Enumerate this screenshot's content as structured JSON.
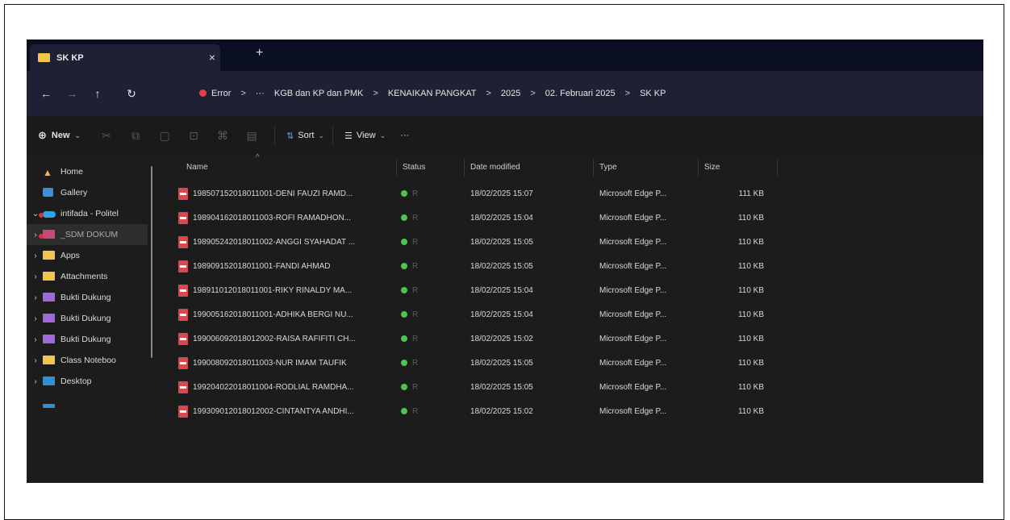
{
  "tab": {
    "title": "SK KP",
    "close": "×",
    "new_tab": "+"
  },
  "address": {
    "breadcrumbs": [
      "Error",
      "···",
      "KGB dan KP dan PMK",
      "KENAIKAN PANGKAT",
      "2025",
      "02. Februari 2025",
      "SK KP"
    ],
    "separator": ">"
  },
  "toolbar": {
    "new_label": "New",
    "sort_label": "Sort",
    "view_label": "View",
    "more_label": "···"
  },
  "sidebar": {
    "items": [
      {
        "label": "Home",
        "icon": "home-icon"
      },
      {
        "label": "Gallery",
        "icon": "gallery-icon"
      },
      {
        "label": "intifada - Politel",
        "icon": "onedrive-icon"
      },
      {
        "label": "_SDM DOKUM",
        "icon": "folder-icon"
      },
      {
        "label": "Apps",
        "icon": "folder-icon"
      },
      {
        "label": "Attachments",
        "icon": "folder-icon"
      },
      {
        "label": "Bukti Dukung",
        "icon": "folder-icon"
      },
      {
        "label": "Bukti Dukung",
        "icon": "folder-icon"
      },
      {
        "label": "Bukti Dukung",
        "icon": "folder-icon"
      },
      {
        "label": "Class Noteboo",
        "icon": "folder-icon"
      },
      {
        "label": "Desktop",
        "icon": "folder-icon"
      }
    ]
  },
  "columns": {
    "name": "Name",
    "status": "Status",
    "date": "Date modified",
    "type": "Type",
    "size": "Size"
  },
  "files": [
    {
      "name": "198507152018011001-DENI FAUZI RAMD...",
      "status": "R",
      "date": "18/02/2025 15:07",
      "type": "Microsoft Edge P...",
      "size": "111 KB"
    },
    {
      "name": "198904162018011003-ROFI RAMADHON...",
      "status": "R",
      "date": "18/02/2025 15:04",
      "type": "Microsoft Edge P...",
      "size": "110 KB"
    },
    {
      "name": "198905242018011002-ANGGI SYAHADAT ...",
      "status": "R",
      "date": "18/02/2025 15:05",
      "type": "Microsoft Edge P...",
      "size": "110 KB"
    },
    {
      "name": "198909152018011001-FANDI AHMAD",
      "status": "R",
      "date": "18/02/2025 15:05",
      "type": "Microsoft Edge P...",
      "size": "110 KB"
    },
    {
      "name": "198911012018011001-RIKY RINALDY MA...",
      "status": "R",
      "date": "18/02/2025 15:04",
      "type": "Microsoft Edge P...",
      "size": "110 KB"
    },
    {
      "name": "199005162018011001-ADHIKA BERGI NU...",
      "status": "R",
      "date": "18/02/2025 15:04",
      "type": "Microsoft Edge P...",
      "size": "110 KB"
    },
    {
      "name": "199006092018012002-RAISA RAFIFITI CH...",
      "status": "R",
      "date": "18/02/2025 15:02",
      "type": "Microsoft Edge P...",
      "size": "110 KB"
    },
    {
      "name": "199008092018011003-NUR IMAM TAUFIK",
      "status": "R",
      "date": "18/02/2025 15:05",
      "type": "Microsoft Edge P...",
      "size": "110 KB"
    },
    {
      "name": "199204022018011004-RODLIAL RAMDHA...",
      "status": "R",
      "date": "18/02/2025 15:05",
      "type": "Microsoft Edge P...",
      "size": "110 KB"
    },
    {
      "name": "199309012018012002-CINTANTYA ANDHI...",
      "status": "R",
      "date": "18/02/2025 15:02",
      "type": "Microsoft Edge P...",
      "size": "110 KB"
    }
  ]
}
